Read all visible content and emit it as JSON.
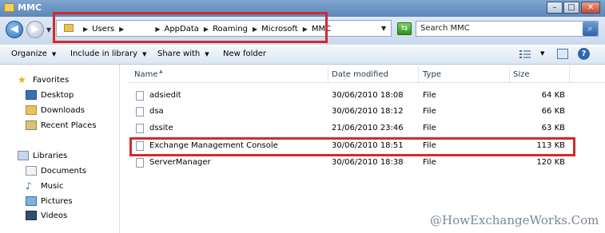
{
  "window": {
    "title": "MMC",
    "minimize": "–",
    "maximize": "□",
    "close": "✕"
  },
  "address": {
    "crumbs": [
      "Users",
      "",
      "AppData",
      "Roaming",
      "Microsoft",
      "MMC"
    ],
    "search_placeholder": "Search MMC"
  },
  "toolbar": {
    "organize": "Organize",
    "include": "Include in library",
    "share": "Share with",
    "newfolder": "New folder"
  },
  "nav": {
    "favorites": "Favorites",
    "desktop": "Desktop",
    "downloads": "Downloads",
    "recent": "Recent Places",
    "libraries": "Libraries",
    "documents": "Documents",
    "music": "Music",
    "pictures": "Pictures",
    "videos": "Videos"
  },
  "columns": {
    "name": "Name",
    "date": "Date modified",
    "type": "Type",
    "size": "Size"
  },
  "files": [
    {
      "name": "adsiedit",
      "date": "30/06/2010 18:08",
      "type": "File",
      "size": "64 KB"
    },
    {
      "name": "dsa",
      "date": "30/06/2010 18:12",
      "type": "File",
      "size": "66 KB"
    },
    {
      "name": "dssite",
      "date": "21/06/2010 23:46",
      "type": "File",
      "size": "63 KB"
    },
    {
      "name": "Exchange Management Console",
      "date": "30/06/2010 18:51",
      "type": "File",
      "size": "113 KB"
    },
    {
      "name": "ServerManager",
      "date": "30/06/2010 18:38",
      "type": "File",
      "size": "120 KB"
    }
  ],
  "watermark": "@HowExchangeWorks.Com",
  "colors": {
    "highlight": "#d42a2a",
    "titlebar": "#6a92c4"
  }
}
